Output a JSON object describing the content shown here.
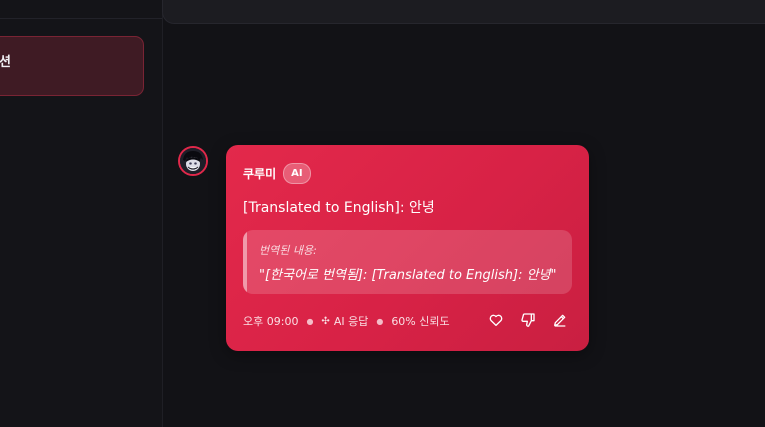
{
  "sidebar": {
    "active_item_label": "션"
  },
  "message": {
    "sender_name": "쿠루미",
    "badge": "AI",
    "text": "[Translated to English]: 안녕",
    "translation": {
      "label": "번역된 내용:",
      "text": "\"[한국어로 번역됨]: [Translated to English]: 안녕\""
    },
    "meta": {
      "time": "오후 09:00",
      "type": "AI 응답",
      "confidence": "60% 신뢰도"
    },
    "actions": [
      "heart-icon",
      "thumbs-down-icon",
      "edit-icon"
    ]
  },
  "colors": {
    "accent": "#e3294b",
    "background": "#121216",
    "sidebar_active_bg": "#3f1b24"
  }
}
